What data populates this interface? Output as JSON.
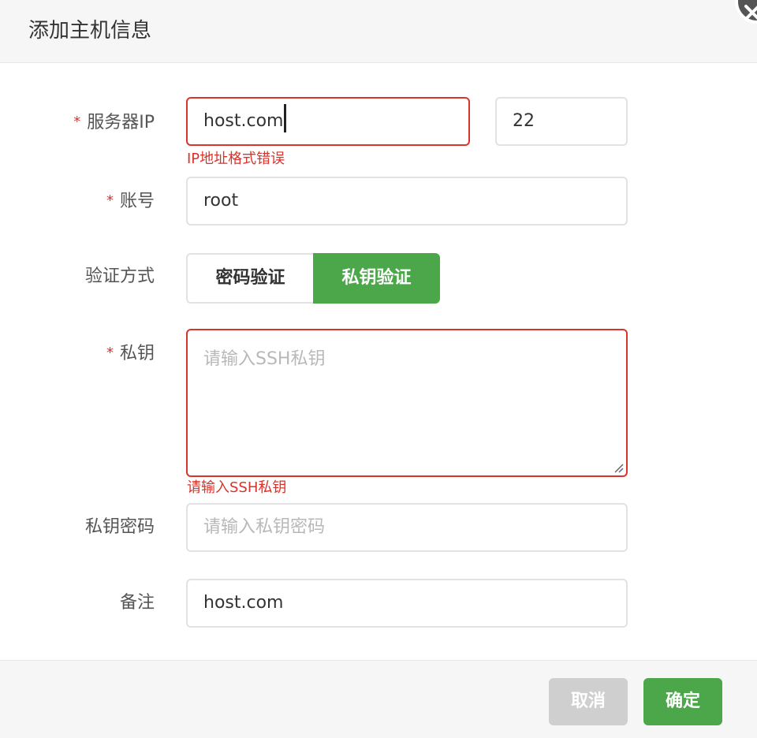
{
  "dialog": {
    "title": "添加主机信息"
  },
  "form": {
    "required_mark": "*",
    "server_ip": {
      "label": "服务器IP",
      "value": "host.com",
      "port": "22",
      "error": "IP地址格式错误"
    },
    "account": {
      "label": "账号",
      "value": "root"
    },
    "auth_method": {
      "label": "验证方式",
      "options": [
        "密码验证",
        "私钥验证"
      ],
      "selected": "私钥验证"
    },
    "private_key": {
      "label": "私钥",
      "placeholder": "请输入SSH私钥",
      "error": "请输入SSH私钥"
    },
    "key_password": {
      "label": "私钥密码",
      "placeholder": "请输入私钥密码"
    },
    "remark": {
      "label": "备注",
      "value": "host.com"
    }
  },
  "footer": {
    "cancel_label": "取消",
    "confirm_label": "确定"
  },
  "colors": {
    "accent": "#4ca74a",
    "error": "#d9342b",
    "cancel_bg": "#cfcfcf"
  },
  "icons": {
    "close": "close-icon",
    "resize": "resize-grip-icon"
  }
}
